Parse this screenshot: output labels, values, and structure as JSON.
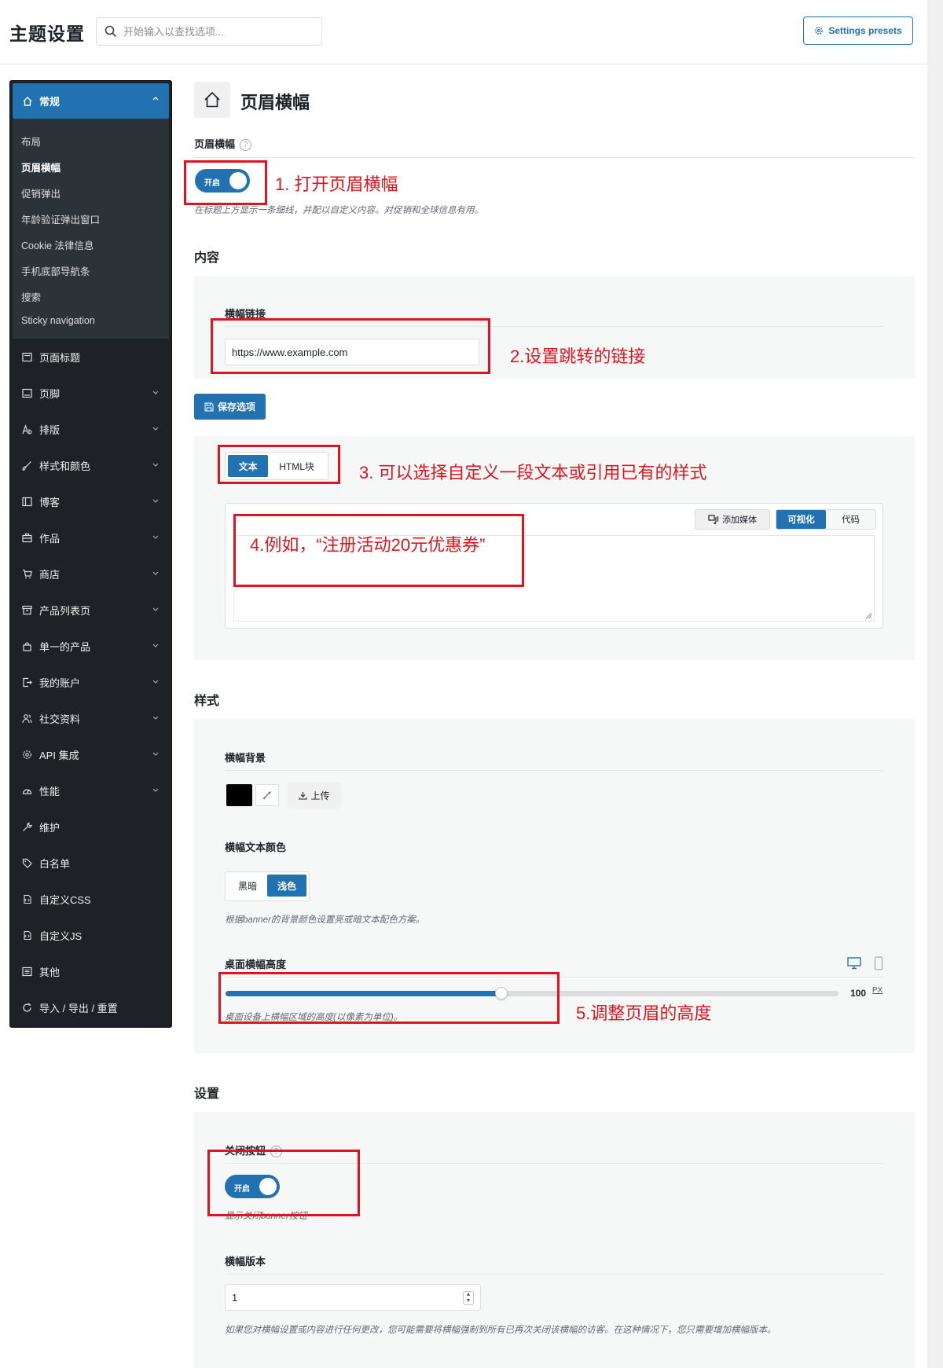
{
  "header": {
    "title": "主题设置",
    "search_placeholder": "开始输入以查找选项...",
    "presets_label": "Settings presets"
  },
  "sidebar": {
    "active": {
      "label": "常规",
      "icon": "home-icon"
    },
    "sub_items": [
      {
        "label": "布局"
      },
      {
        "label": "页眉横幅",
        "current": true
      },
      {
        "label": "促销弹出"
      },
      {
        "label": "年龄验证弹出窗口"
      },
      {
        "label": "Cookie 法律信息"
      },
      {
        "label": "手机底部导航条"
      },
      {
        "label": "搜索"
      },
      {
        "label": "Sticky navigation"
      }
    ],
    "items": [
      {
        "label": "页面标题",
        "icon": "title-icon",
        "expandable": false
      },
      {
        "label": "页脚",
        "icon": "footer-icon",
        "expandable": true
      },
      {
        "label": "排版",
        "icon": "typography-icon",
        "expandable": true
      },
      {
        "label": "样式和颜色",
        "icon": "brush-icon",
        "expandable": true
      },
      {
        "label": "博客",
        "icon": "blog-icon",
        "expandable": true
      },
      {
        "label": "作品",
        "icon": "portfolio-icon",
        "expandable": true
      },
      {
        "label": "商店",
        "icon": "cart-icon",
        "expandable": true
      },
      {
        "label": "产品列表页",
        "icon": "archive-icon",
        "expandable": true
      },
      {
        "label": "单一的产品",
        "icon": "bag-icon",
        "expandable": true
      },
      {
        "label": "我的账户",
        "icon": "account-icon",
        "expandable": true
      },
      {
        "label": "社交资料",
        "icon": "users-icon",
        "expandable": true
      },
      {
        "label": "API 集成",
        "icon": "gear-icon",
        "expandable": true
      },
      {
        "label": "性能",
        "icon": "gauge-icon",
        "expandable": true
      },
      {
        "label": "维护",
        "icon": "wrench-icon",
        "expandable": false
      },
      {
        "label": "白名单",
        "icon": "tag-icon",
        "expandable": false
      },
      {
        "label": "自定义CSS",
        "icon": "css-icon",
        "expandable": false
      },
      {
        "label": "自定义JS",
        "icon": "js-icon",
        "expandable": false
      },
      {
        "label": "其他",
        "icon": "list-icon",
        "expandable": false
      },
      {
        "label": "导入 / 导出 / 重置",
        "icon": "reset-icon",
        "expandable": false
      }
    ]
  },
  "page": {
    "title": "页眉横幅",
    "icon": "home-icon"
  },
  "banner_toggle": {
    "label": "页眉横幅",
    "state_label": "开启",
    "description": "在标题上方显示一条细线，并配以自定义内容。对促销和全球信息有用。"
  },
  "content_section": {
    "title": "内容",
    "link_label": "横幅链接",
    "link_value": "https://www.example.com",
    "save_label": "保存选项",
    "type_options": [
      "文本",
      "HTML块"
    ],
    "type_active": "文本",
    "editor": {
      "add_media": "添加媒体",
      "modes": [
        "可视化",
        "代码"
      ],
      "mode_active": "可视化"
    }
  },
  "style_section": {
    "title": "样式",
    "bg_label": "横幅背景",
    "bg_color": "#000000",
    "upload_label": "上传",
    "text_color_label": "横幅文本颜色",
    "text_color_options": [
      "黑暗",
      "浅色"
    ],
    "text_color_active": "浅色",
    "text_color_desc": "根据banner的背景颜色设置亮或暗文本配色方案。",
    "height_label": "桌面横幅高度",
    "height_value": "100",
    "height_unit": "PX",
    "height_fraction": 0.45,
    "height_desc": "桌面设备上横幅区域的高度(以像素为单位)。"
  },
  "settings_section": {
    "title": "设置",
    "close_label": "关闭按钮",
    "close_state_label": "开启",
    "close_desc": "显示关闭banner按钮",
    "version_label": "横幅版本",
    "version_value": "1",
    "version_desc": "如果您对横幅设置或内容进行任何更改，您可能需要将横幅强制到所有已再次关闭该横幅的访客。在这种情况下，您只需要增加横幅版本。"
  },
  "annotations": {
    "a1": "1. 打开页眉横幅",
    "a2": "2.设置跳转的链接",
    "a3": "3. 可以选择自定义一段文本或引用已有的样式",
    "a4": "4.例如，“注册活动20元优惠券”",
    "a5": "5.调整页眉的高度"
  },
  "colors": {
    "accent": "#2271b1",
    "annotation": "#e0141e",
    "sidebar_bg": "#1e2227"
  }
}
